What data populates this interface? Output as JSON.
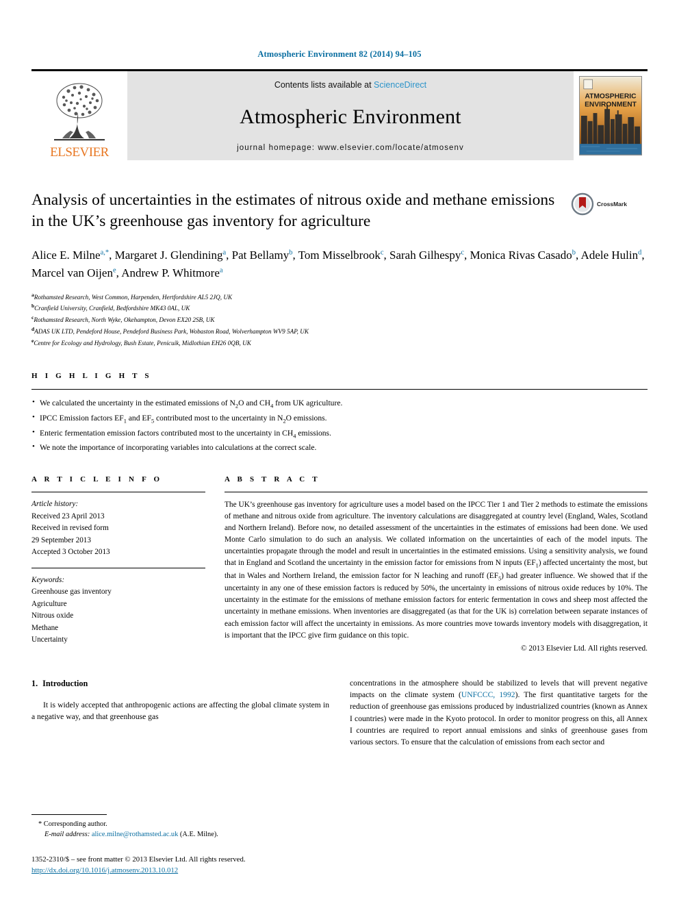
{
  "running_head": "Atmospheric Environment 82 (2014) 94–105",
  "banner": {
    "publisher_name": "ELSEVIER",
    "contents_prefix": "Contents lists available at",
    "sciencedirect": "ScienceDirect",
    "journal_name": "Atmospheric Environment",
    "homepage": "journal homepage: www.elsevier.com/locate/atmosenv",
    "cover_title_line1": "ATMOSPHERIC",
    "cover_title_line2": "ENVIRONMENT"
  },
  "article": {
    "title": "Analysis of uncertainties in the estimates of nitrous oxide and methane emissions in the UK’s greenhouse gas inventory for agriculture",
    "crossmark_label": "CrossMark",
    "authors_line1": "Alice E. Milne",
    "authors": [
      {
        "name": "Alice E. Milne",
        "sup": "a,*"
      },
      {
        "name": "Margaret J. Glendining",
        "sup": "a"
      },
      {
        "name": "Pat Bellamy",
        "sup": "b"
      },
      {
        "name": "Tom Misselbrook",
        "sup": "c"
      },
      {
        "name": "Sarah Gilhespy",
        "sup": "c"
      },
      {
        "name": "Monica Rivas Casado",
        "sup": "b"
      },
      {
        "name": "Adele Hulin",
        "sup": "d"
      },
      {
        "name": "Marcel van Oijen",
        "sup": "e"
      },
      {
        "name": "Andrew P. Whitmore",
        "sup": "a"
      }
    ],
    "affiliations": [
      {
        "mark": "a",
        "text": "Rothamsted Research, West Common, Harpenden, Hertfordshire AL5 2JQ, UK"
      },
      {
        "mark": "b",
        "text": "Cranfield University, Cranfield, Bedfordshire MK43 0AL, UK"
      },
      {
        "mark": "c",
        "text": "Rothamsted Research, North Wyke, Okehampton, Devon EX20 2SB, UK"
      },
      {
        "mark": "d",
        "text": "ADAS UK LTD, Pendeford House, Pendeford Business Park, Wobaston Road, Wolverhampton WV9 5AP, UK"
      },
      {
        "mark": "e",
        "text": "Centre for Ecology and Hydrology, Bush Estate, Penicuik, Midlothian EH26 0QB, UK"
      }
    ]
  },
  "highlights": {
    "heading": "H I G H L I G H T S",
    "items_html": [
      "We calculated the uncertainty in the estimated emissions of N<sub>2</sub>O and CH<sub>4</sub> from UK agriculture.",
      "IPCC Emission factors EF<sub>1</sub> and EF<sub>5</sub> contributed most to the uncertainty in N<sub>2</sub>O emissions.",
      "Enteric fermentation emission factors contributed most to the uncertainty in CH<sub>4</sub> emissions.",
      "We note the importance of incorporating variables into calculations at the correct scale."
    ]
  },
  "article_info": {
    "heading": "A R T I C L E  I N F O",
    "history_label": "Article history:",
    "history": [
      "Received 23 April 2013",
      "Received in revised form",
      "29 September 2013",
      "Accepted 3 October 2013"
    ],
    "keywords_label": "Keywords:",
    "keywords": [
      "Greenhouse gas inventory",
      "Agriculture",
      "Nitrous oxide",
      "Methane",
      "Uncertainty"
    ]
  },
  "abstract": {
    "heading": "A B S T R A C T",
    "body_html": "The UK’s greenhouse gas inventory for agriculture uses a model based on the IPCC Tier 1 and Tier 2 methods to estimate the emissions of methane and nitrous oxide from agriculture. The inventory calculations are disaggregated at country level (England, Wales, Scotland and Northern Ireland). Before now, no detailed assessment of the uncertainties in the estimates of emissions had been done. We used Monte Carlo simulation to do such an analysis. We collated information on the uncertainties of each of the model inputs. The uncertainties propagate through the model and result in uncertainties in the estimated emissions. Using a sensitivity analysis, we found that in England and Scotland the uncertainty in the emission factor for emissions from N inputs (EF<sub>1</sub>) affected uncertainty the most, but that in Wales and Northern Ireland, the emission factor for N leaching and runoff (EF<sub>5</sub>) had greater influence. We showed that if the uncertainty in any one of these emission factors is reduced by 50%, the uncertainty in emissions of nitrous oxide reduces by 10%. The uncertainty in the estimate for the emissions of methane emission factors for enteric fermentation in cows and sheep most affected the uncertainty in methane emissions. When inventories are disaggregated (as that for the UK is) correlation between separate instances of each emission factor will affect the uncertainty in emissions. As more countries move towards inventory models with disaggregation, it is important that the IPCC give firm guidance on this topic.",
    "copyright": "© 2013 Elsevier Ltd. All rights reserved."
  },
  "introduction": {
    "number": "1.",
    "heading": "Introduction",
    "left_para": "It is widely accepted that anthropogenic actions are affecting the global climate system in a negative way, and that greenhouse gas",
    "right_para_before_cite": "concentrations in the atmosphere should be stabilized to levels that will prevent negative impacts on the climate system (",
    "right_citation": "UNFCCC, 1992",
    "right_para_after_cite": "). The first quantitative targets for the reduction of greenhouse gas emissions produced by industrialized countries (known as Annex I countries) were made in the Kyoto protocol. In order to monitor progress on this, all Annex I countries are required to report annual emissions and sinks of greenhouse gases from various sectors. To ensure that the calculation of emissions from each sector and"
  },
  "footnotes": {
    "corresponding": "* Corresponding author.",
    "email_label": "E-mail address:",
    "email": "alice.milne@rothamsted.ac.uk",
    "email_suffix": "(A.E. Milne)."
  },
  "footer": {
    "issn_line": "1352-2310/$ – see front matter © 2013 Elsevier Ltd. All rights reserved.",
    "doi": "http://dx.doi.org/10.1016/j.atmosenv.2013.10.012"
  },
  "colors": {
    "link_blue": "#0a6ea1",
    "sciencedirect_blue": "#2a93c9",
    "elsevier_orange": "#E87722",
    "banner_grey": "#e3e3e3"
  }
}
